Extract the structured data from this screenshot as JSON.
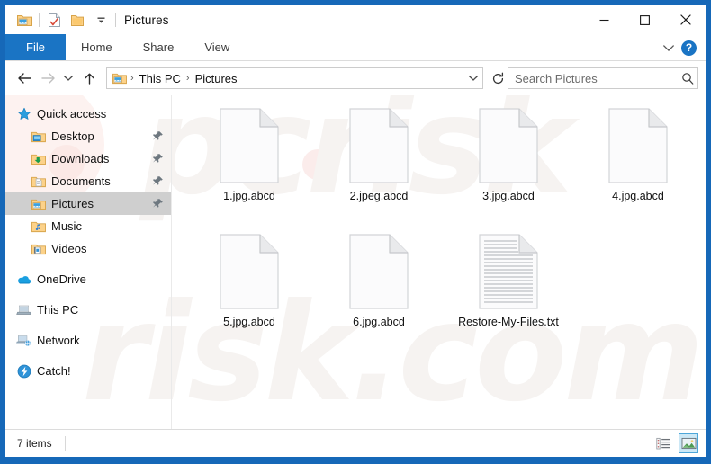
{
  "window": {
    "title": "Pictures",
    "quick_access": [
      {
        "name": "pictures-folder-icon",
        "label": "Pictures"
      },
      {
        "name": "properties-icon",
        "label": "Properties"
      },
      {
        "name": "new-folder-icon",
        "label": "New folder"
      },
      {
        "name": "customize-quick-access-icon",
        "label": "Customize Quick Access Toolbar"
      }
    ],
    "controls": {
      "minimize": "–",
      "maximize": "□",
      "close": "✕"
    }
  },
  "ribbon": {
    "tabs": [
      {
        "label": "File",
        "active": true
      },
      {
        "label": "Home",
        "active": false
      },
      {
        "label": "Share",
        "active": false
      },
      {
        "label": "View",
        "active": false
      }
    ],
    "collapse_label": "∨",
    "help_label": "?"
  },
  "address": {
    "back_label": "←",
    "forward_label": "→",
    "recent_label": "∨",
    "up_label": "↑",
    "breadcrumb": [
      "This PC",
      "Pictures"
    ],
    "separator": "›",
    "dropdown_label": "∨",
    "refresh_label": "↻"
  },
  "search": {
    "placeholder": "Search Pictures",
    "value": "",
    "icon": "search-icon"
  },
  "sidebar": {
    "groups": [
      {
        "items": [
          {
            "label": "Quick access",
            "icon": "star-icon",
            "indent": false,
            "pinned": false,
            "selected": false
          },
          {
            "label": "Desktop",
            "icon": "desktop-folder-icon",
            "indent": true,
            "pinned": true,
            "selected": false
          },
          {
            "label": "Downloads",
            "icon": "downloads-folder-icon",
            "indent": true,
            "pinned": true,
            "selected": false
          },
          {
            "label": "Documents",
            "icon": "documents-folder-icon",
            "indent": true,
            "pinned": true,
            "selected": false
          },
          {
            "label": "Pictures",
            "icon": "pictures-folder-icon",
            "indent": true,
            "pinned": true,
            "selected": true
          },
          {
            "label": "Music",
            "icon": "music-folder-icon",
            "indent": true,
            "pinned": false,
            "selected": false
          },
          {
            "label": "Videos",
            "icon": "videos-folder-icon",
            "indent": true,
            "pinned": false,
            "selected": false
          }
        ]
      },
      {
        "items": [
          {
            "label": "OneDrive",
            "icon": "onedrive-cloud-icon",
            "indent": false,
            "pinned": false,
            "selected": false
          }
        ]
      },
      {
        "items": [
          {
            "label": "This PC",
            "icon": "this-pc-icon",
            "indent": false,
            "pinned": false,
            "selected": false
          }
        ]
      },
      {
        "items": [
          {
            "label": "Network",
            "icon": "network-icon",
            "indent": false,
            "pinned": false,
            "selected": false
          }
        ]
      },
      {
        "items": [
          {
            "label": "Catch!",
            "icon": "catch-app-icon",
            "indent": false,
            "pinned": false,
            "selected": false
          }
        ]
      }
    ]
  },
  "files": [
    {
      "name": "1.jpg.abcd",
      "type": "blank"
    },
    {
      "name": "2.jpeg.abcd",
      "type": "blank"
    },
    {
      "name": "3.jpg.abcd",
      "type": "blank"
    },
    {
      "name": "4.jpg.abcd",
      "type": "blank"
    },
    {
      "name": "5.jpg.abcd",
      "type": "blank"
    },
    {
      "name": "6.jpg.abcd",
      "type": "blank"
    },
    {
      "name": "Restore-My-Files.txt",
      "type": "text"
    }
  ],
  "status": {
    "item_count": "7 items",
    "views": [
      {
        "name": "details-view-button",
        "active": false
      },
      {
        "name": "large-icons-view-button",
        "active": true
      }
    ]
  },
  "watermark": {
    "line1": "pcrisk",
    "line2": "risk.com"
  },
  "colors": {
    "frame_blue": "#1668b8",
    "tab_blue": "#1a74c4",
    "selection_gray": "#cfcfcf",
    "view_active": "#cce8f6"
  }
}
